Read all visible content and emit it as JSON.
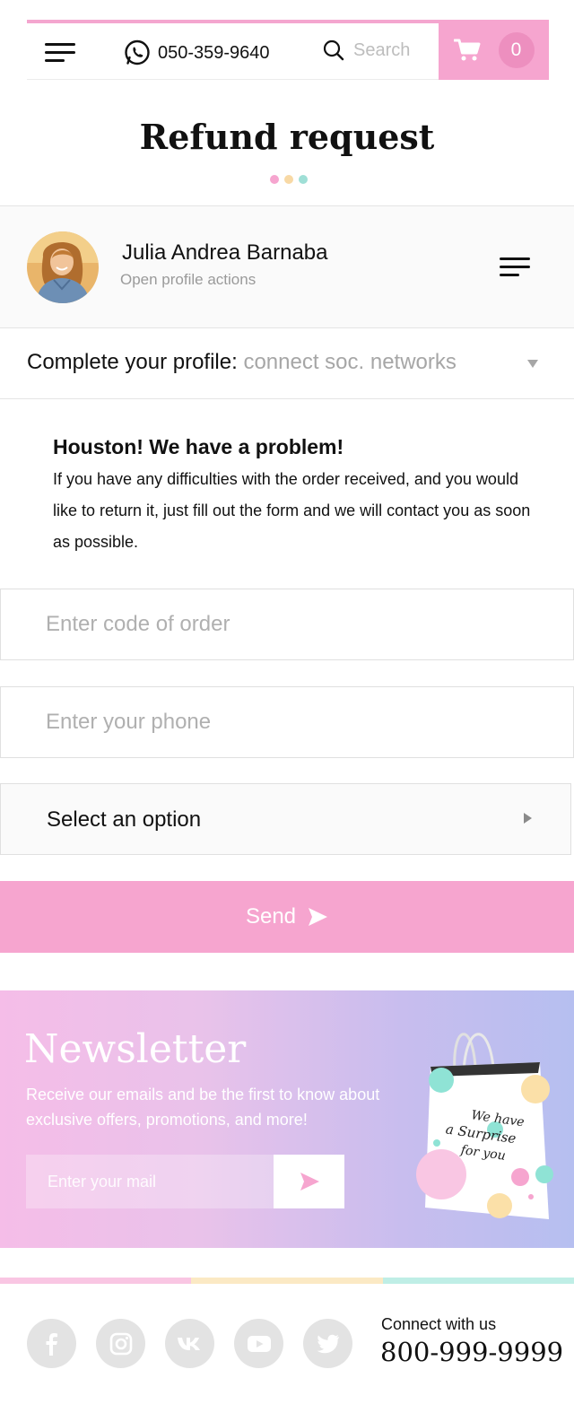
{
  "header": {
    "phone": "050-359-9640",
    "search_placeholder": "Search",
    "cart_count": "0"
  },
  "page": {
    "title": "Refund request",
    "dot_colors": [
      "#f6a5cf",
      "#f8d9a5",
      "#9fdfd6"
    ]
  },
  "profile": {
    "name": "Julia Andrea Barnaba",
    "subtitle": "Open profile actions"
  },
  "complete_profile": {
    "label": "Complete your profile:",
    "value": "connect soc. networks"
  },
  "problem": {
    "title": "Houston! We have a problem!",
    "text": "If you have any difficulties with the order received, and you would like to return it, just fill out the form and we will contact you as soon as possible."
  },
  "form": {
    "order_placeholder": "Enter code of order",
    "phone_placeholder": "Enter your phone",
    "select_label": "Select an option",
    "send_label": "Send"
  },
  "newsletter": {
    "title": "Newsletter",
    "text": "Receive our emails and be the first to know about exclusive offers, promotions, and more!",
    "email_placeholder": "Enter your mail",
    "bag_lines": [
      "We have",
      "a Surprise",
      "for you"
    ]
  },
  "footer": {
    "strip_colors": [
      "#f9c6e3",
      "#fbe9c4",
      "#bfeee6"
    ],
    "socials": [
      "facebook-icon",
      "instagram-icon",
      "vk-icon",
      "youtube-icon",
      "twitter-icon"
    ],
    "connect_label": "Connect with us",
    "connect_phone": "800-999-9999"
  },
  "colors": {
    "accent_pink": "#f6a5cf",
    "social_gray": "#e3e3e3"
  }
}
